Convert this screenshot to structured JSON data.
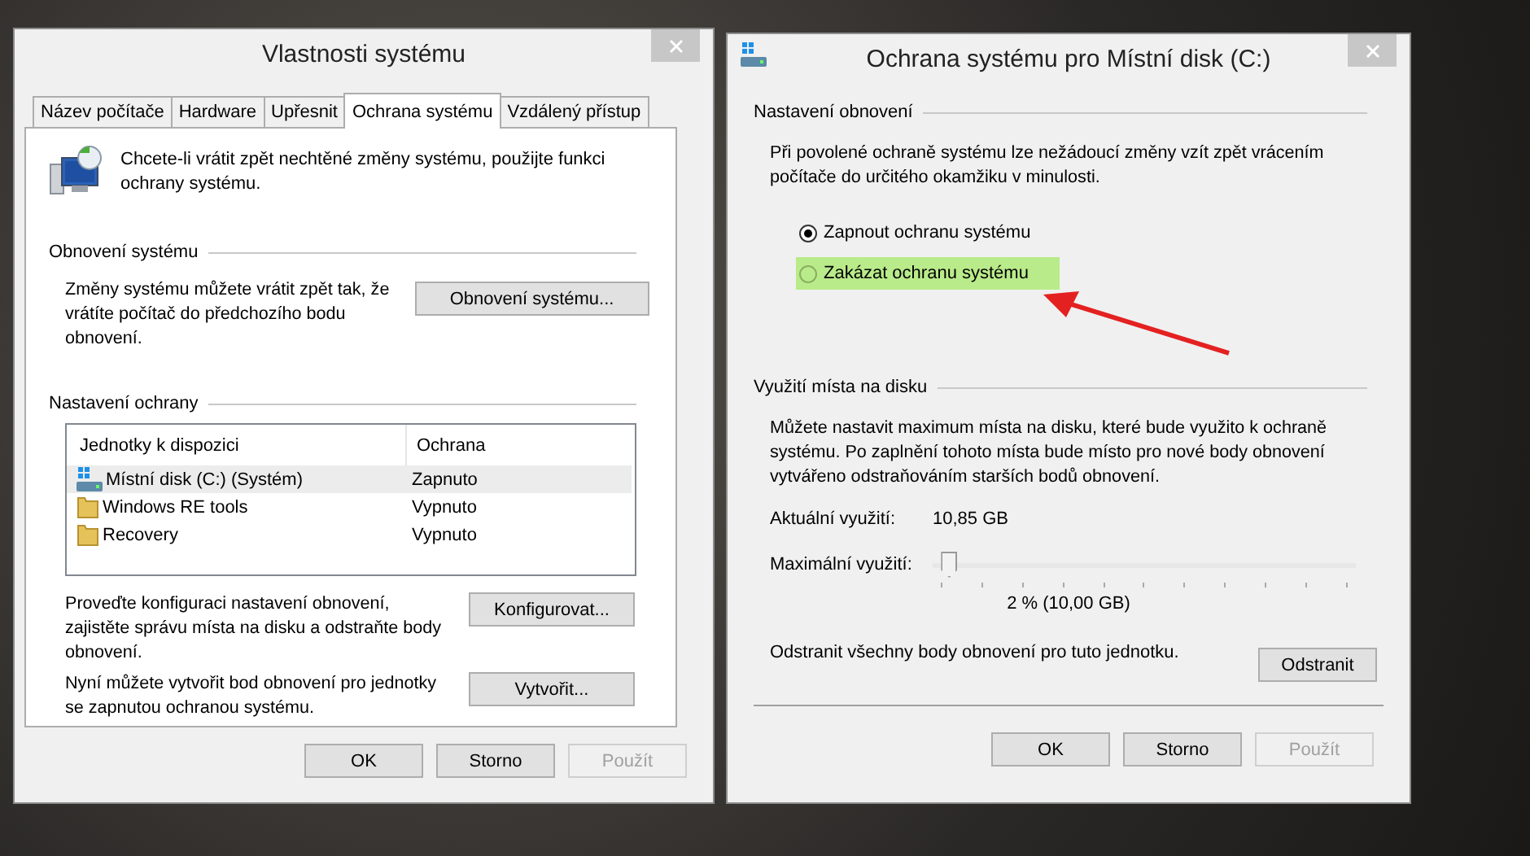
{
  "system_properties": {
    "title": "Vlastnosti systému",
    "tabs": [
      {
        "label": "Název počítače",
        "selected": false
      },
      {
        "label": "Hardware",
        "selected": false
      },
      {
        "label": "Upřesnit",
        "selected": false
      },
      {
        "label": "Ochrana systému",
        "selected": true
      },
      {
        "label": "Vzdálený přístup",
        "selected": false
      }
    ],
    "intro": "Chcete-li vrátit zpět nechtěné změny systému, použijte funkci ochrany systému.",
    "restore": {
      "heading": "Obnovení systému",
      "text": "Změny systému můžete vrátit zpět tak, že vrátíte počítač do předchozího bodu obnovení.",
      "button": "Obnovení systému..."
    },
    "protection": {
      "heading": "Nastavení ochrany",
      "columns": [
        "Jednotky k dispozici",
        "Ochrana"
      ],
      "rows": [
        {
          "kind": "system",
          "drive": "Místní disk (C:) (Systém)",
          "protection": "Zapnuto",
          "selected": true
        },
        {
          "kind": "folder",
          "drive": "Windows RE tools",
          "protection": "Vypnuto",
          "selected": false
        },
        {
          "kind": "folder",
          "drive": "Recovery",
          "protection": "Vypnuto",
          "selected": false
        }
      ],
      "configure": {
        "text": "Proveďte konfiguraci nastavení obnovení, zajistěte správu místa na disku a odstraňte body obnovení.",
        "button": "Konfigurovat..."
      },
      "create": {
        "text": "Nyní můžete vytvořit bod obnovení pro jednotky se zapnutou ochranou systému.",
        "button": "Vytvořit..."
      }
    },
    "buttons": [
      {
        "label": "OK",
        "disabled": false
      },
      {
        "label": "Storno",
        "disabled": false
      },
      {
        "label": "Použít",
        "disabled": true
      }
    ]
  },
  "protection_dialog": {
    "title": "Ochrana systému pro Místní disk (C:)",
    "restore_settings": {
      "heading": "Nastavení obnovení",
      "text": "Při povolené ochraně systému lze nežádoucí změny vzít zpět vrácením počítače do určitého okamžiku v minulosti.",
      "options": [
        {
          "label": "Zapnout ochranu systému",
          "selected": true,
          "highlighted": false
        },
        {
          "label": "Zakázat ochranu systému",
          "selected": false,
          "highlighted": true
        }
      ]
    },
    "disk_usage": {
      "heading": "Využití místa na disku",
      "text": "Můžete nastavit maximum místa na disku, které bude využito k ochraně systému. Po zaplnění tohoto místa bude místo pro nové body obnovení vytvářeno odstraňováním starších bodů obnovení.",
      "current_label": "Aktuální využití:",
      "current_value": "10,85 GB",
      "max_label": "Maximální využití:",
      "level": 0.02,
      "reading": "2 % (10,00 GB)",
      "delete_text": "Odstranit všechny body obnovení pro tuto jednotku.",
      "delete_button": "Odstranit"
    },
    "buttons": [
      {
        "label": "OK",
        "disabled": false
      },
      {
        "label": "Storno",
        "disabled": false
      },
      {
        "label": "Použít",
        "disabled": true
      }
    ]
  }
}
